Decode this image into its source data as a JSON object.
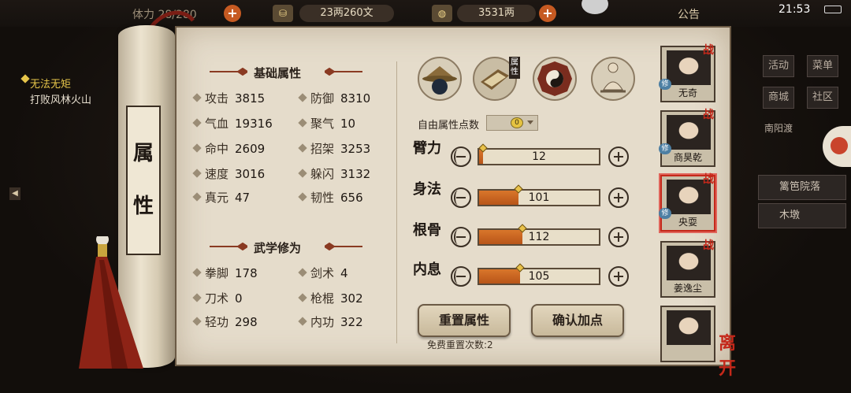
{
  "hud": {
    "partial_left": "体力 28/280",
    "copper": "23两260文",
    "silver": "3531两",
    "notice": "公告",
    "time": "21:53"
  },
  "quest": {
    "title": "无法无矩",
    "desc": "打败风林火山"
  },
  "scroll_title": [
    "属",
    "性"
  ],
  "basic": {
    "title": "基础属性",
    "stats": [
      {
        "label": "攻击",
        "value": "3815"
      },
      {
        "label": "防御",
        "value": "8310"
      },
      {
        "label": "气血",
        "value": "19316"
      },
      {
        "label": "聚气",
        "value": "10"
      },
      {
        "label": "命中",
        "value": "2609"
      },
      {
        "label": "招架",
        "value": "3253"
      },
      {
        "label": "速度",
        "value": "3016"
      },
      {
        "label": "躲闪",
        "value": "3132"
      },
      {
        "label": "真元",
        "value": "47"
      },
      {
        "label": "韧性",
        "value": "656"
      }
    ]
  },
  "martial": {
    "title": "武学修为",
    "stats": [
      {
        "label": "拳脚",
        "value": "178"
      },
      {
        "label": "剑术",
        "value": "4"
      },
      {
        "label": "刀术",
        "value": "0"
      },
      {
        "label": "枪棍",
        "value": "302"
      },
      {
        "label": "轻功",
        "value": "298"
      },
      {
        "label": "内功",
        "value": "322"
      }
    ]
  },
  "tabs": {
    "attr_label": "属性",
    "icons": [
      "bamboo-hat-icon",
      "scroll-book-icon",
      "bagua-icon",
      "meditation-figure-icon"
    ]
  },
  "free_points": {
    "label": "自由属性点数",
    "value": "0"
  },
  "attributes": [
    {
      "label": "臂力",
      "value": "12",
      "fill": 0.03
    },
    {
      "label": "身法",
      "value": "101",
      "fill": 0.33
    },
    {
      "label": "根骨",
      "value": "112",
      "fill": 0.36
    },
    {
      "label": "内息",
      "value": "105",
      "fill": 0.34
    }
  ],
  "buttons": {
    "reset": "重置属性",
    "confirm": "确认加点"
  },
  "reset_count": "免费重置次数:2",
  "roster": [
    {
      "name": "无奇",
      "badge": "战",
      "tag": "修"
    },
    {
      "name": "商昊乾",
      "badge": "战",
      "tag": "修"
    },
    {
      "name": "央耍",
      "badge": "战",
      "tag": "修"
    },
    {
      "name": "姜逸尘",
      "badge": "战",
      "tag": ""
    },
    {
      "name": "",
      "badge": "",
      "tag": ""
    }
  ],
  "leave": "离开",
  "right_menu": {
    "items": [
      "活动",
      "菜单",
      "商城",
      "社区"
    ],
    "location": "南阳渡",
    "places": [
      "篱笆院落",
      "木墩"
    ]
  },
  "colors": {
    "accent": "#c4281a",
    "fill": "#d9762b",
    "paper": "#e5dccb"
  }
}
